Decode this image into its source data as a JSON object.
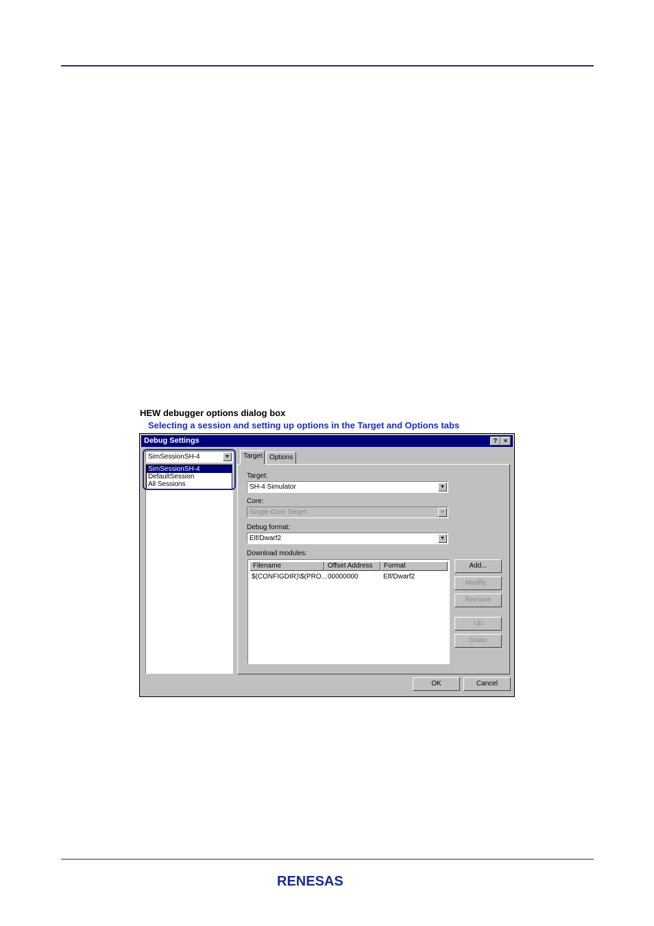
{
  "figure": {
    "title": "HEW debugger options dialog box",
    "subtitle": "Selecting a session and setting up options in the Target and Options tabs"
  },
  "dialog": {
    "title": "Debug Settings",
    "help_button": "?",
    "close_button": "×",
    "session_combo": {
      "value": "SimSessionSH-4",
      "options": [
        "SimSessionSH-4",
        "DefaultSession",
        "All Sessions"
      ],
      "selected_index": 0
    },
    "tabs": [
      {
        "label": "Target",
        "active": true
      },
      {
        "label": "Options",
        "active": false
      }
    ],
    "target": {
      "target_label": "Target:",
      "target_value": "SH-4 Simulator",
      "core_label": "Core:",
      "core_value": "Single Core Target",
      "debug_format_label": "Debug format:",
      "debug_format_value": "Elf/Dwarf2",
      "download_modules_label": "Download modules:",
      "columns": [
        "Filename",
        "Offset Address",
        "Format"
      ],
      "rows": [
        {
          "filename": "$(CONFIGDIR)\\$(PRO...",
          "offset": "00000000",
          "format": "Elf/Dwarf2"
        }
      ],
      "buttons": {
        "add": "Add...",
        "modify": "Modify...",
        "remove": "Remove",
        "up": "Up",
        "down": "Down"
      }
    },
    "ok": "OK",
    "cancel": "Cancel"
  },
  "footer": {
    "logo": "RENESAS"
  },
  "colors": {
    "rule": "#1a2a8a",
    "title_bar": "#00007b",
    "subtitle": "#1a2bd0",
    "logo": "#1a2a8a"
  }
}
